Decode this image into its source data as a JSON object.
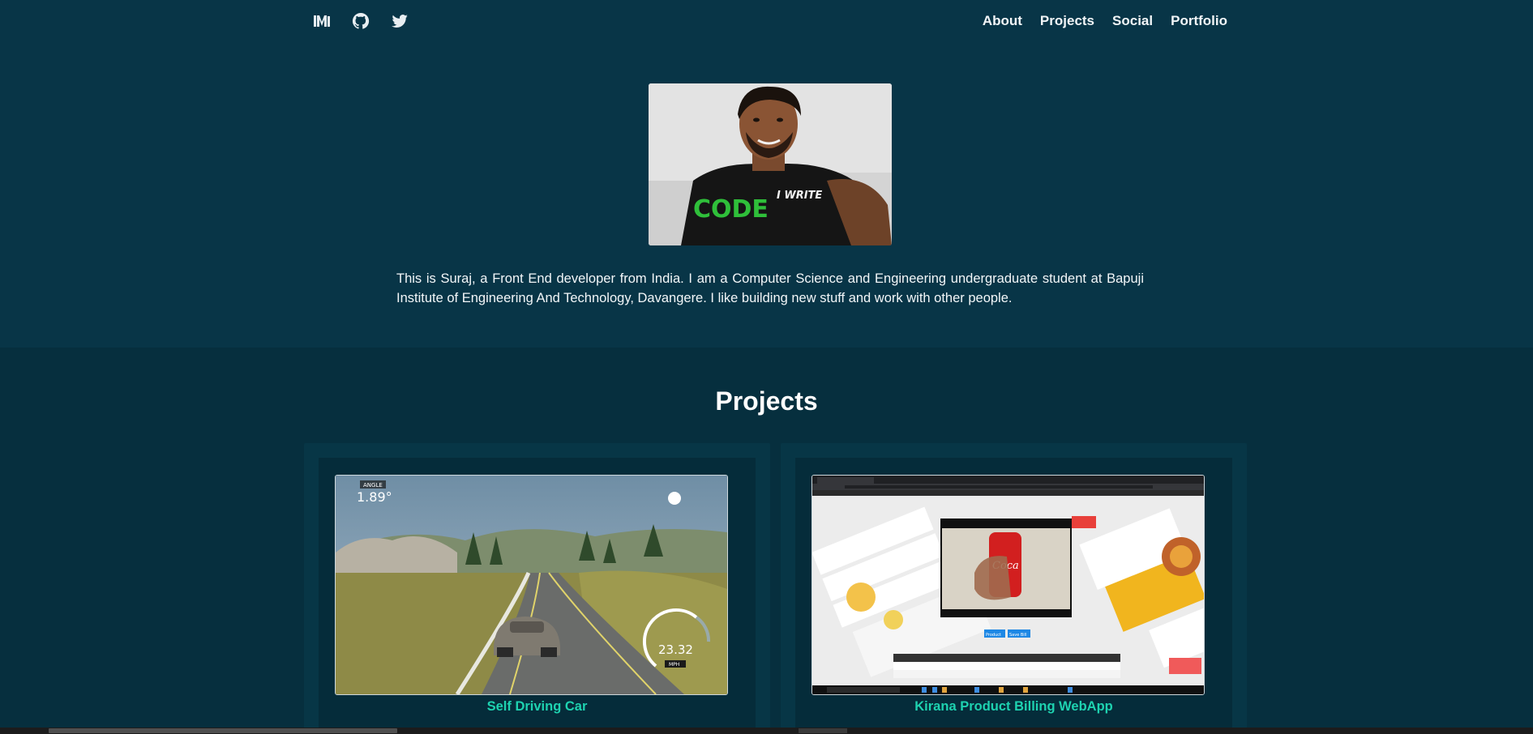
{
  "nav": {
    "icons": [
      "medium-icon",
      "github-icon",
      "twitter-icon"
    ],
    "links": [
      "About",
      "Projects",
      "Social",
      "Portfolio"
    ]
  },
  "hero": {
    "bio": "This is Suraj, a Front End developer from India. I am a Computer Science and Engineering undergraduate student at Bapuji Institute of Engineering And Technology, Davangere. I like building new stuff and work with other people.",
    "shirt_text_line1": "I WRITE",
    "shirt_text_line2": "CODE"
  },
  "projects": {
    "title": "Projects",
    "items": [
      {
        "title": "Self Driving Car",
        "hud_angle_label": "ANGLE",
        "hud_angle_value": "1.89°",
        "hud_speed_value": "23.32",
        "hud_speed_unit": "MPH"
      },
      {
        "title": "Kirana Product Billing WebApp",
        "button_product": "Product",
        "button_save": "Save Bill"
      }
    ]
  },
  "colors": {
    "background": "#062f3e",
    "header_bg": "#083547",
    "accent": "#1ed2b0"
  }
}
